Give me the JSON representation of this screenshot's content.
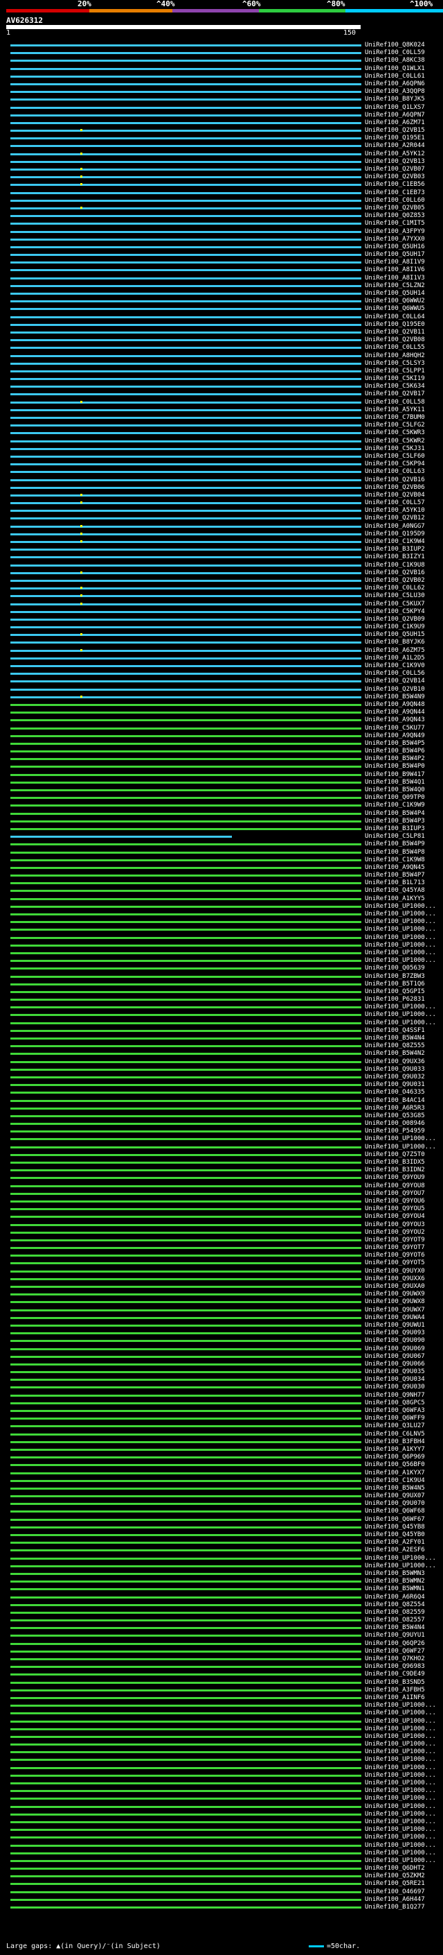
{
  "scale": {
    "labels": [
      "20%",
      "^40%",
      "^60%",
      "^80%",
      "^100%"
    ],
    "colors": [
      "#d40000",
      "#e67e00",
      "#8e44ad",
      "#2ecc40",
      "#00ccff"
    ]
  },
  "query": {
    "name": "AV626312",
    "start": "1",
    "end": "150"
  },
  "hits": [
    {
      "label": "UniRef100_Q8K024",
      "color": "#3cc8f0"
    },
    {
      "label": "UniRef100_C0LL59",
      "color": "#3cc8f0"
    },
    {
      "label": "UniRef100_A8KC38",
      "color": "#3cc8f0"
    },
    {
      "label": "UniRef100_Q1WLX1",
      "color": "#3cc8f0"
    },
    {
      "label": "UniRef100_C0LL61",
      "color": "#3cc8f0"
    },
    {
      "label": "UniRef100_A6QPN6",
      "color": "#3cc8f0"
    },
    {
      "label": "UniRef100_A3QQP8",
      "color": "#3cc8f0"
    },
    {
      "label": "UniRef100_B8YJK5",
      "color": "#3cc8f0"
    },
    {
      "label": "UniRef100_Q1LXS7",
      "color": "#3cc8f0"
    },
    {
      "label": "UniRef100_A6QPN7",
      "color": "#3cc8f0"
    },
    {
      "label": "UniRef100_A6ZM71",
      "color": "#3cc8f0"
    },
    {
      "label": "UniRef100_Q2VB15",
      "color": "#3cc8f0"
    },
    {
      "label": "UniRef100_Q195E1",
      "color": "#3cc8f0"
    },
    {
      "label": "UniRef100_A2R044",
      "color": "#3cc8f0"
    },
    {
      "label": "UniRef100_A5YK12",
      "color": "#3cc8f0"
    },
    {
      "label": "UniRef100_Q2VB13",
      "color": "#3cc8f0"
    },
    {
      "label": "UniRef100_Q2VB07",
      "color": "#3cc8f0"
    },
    {
      "label": "UniRef100_Q2VB03",
      "color": "#3cc8f0"
    },
    {
      "label": "UniRef100_C1EB56",
      "color": "#3cc8f0"
    },
    {
      "label": "UniRef100_C1EB73",
      "color": "#3cc8f0"
    },
    {
      "label": "UniRef100_C0LL60",
      "color": "#3cc8f0"
    },
    {
      "label": "UniRef100_Q2VB05",
      "color": "#3cc8f0"
    },
    {
      "label": "UniRef100_Q0Z853",
      "color": "#3cc8f0"
    },
    {
      "label": "UniRef100_C1MIT5",
      "color": "#3cc8f0"
    },
    {
      "label": "UniRef100_A3FPY9",
      "color": "#3cc8f0"
    },
    {
      "label": "UniRef100_A7YXX0",
      "color": "#3cc8f0"
    },
    {
      "label": "UniRef100_Q5UH16",
      "color": "#3cc8f0"
    },
    {
      "label": "UniRef100_Q5UH17",
      "color": "#3cc8f0"
    },
    {
      "label": "UniRef100_A8I1V9",
      "color": "#3cc8f0"
    },
    {
      "label": "UniRef100_A8I1V6",
      "color": "#3cc8f0"
    },
    {
      "label": "UniRef100_A8I1V3",
      "color": "#3cc8f0"
    },
    {
      "label": "UniRef100_C5LZN2",
      "color": "#3cc8f0"
    },
    {
      "label": "UniRef100_Q5UH14",
      "color": "#3cc8f0"
    },
    {
      "label": "UniRef100_Q6WWU2",
      "color": "#3cc8f0"
    },
    {
      "label": "UniRef100_Q6WWU5",
      "color": "#3cc8f0"
    },
    {
      "label": "UniRef100_C0LL64",
      "color": "#3cc8f0"
    },
    {
      "label": "UniRef100_Q195E0",
      "color": "#3cc8f0"
    },
    {
      "label": "UniRef100_Q2VB11",
      "color": "#3cc8f0"
    },
    {
      "label": "UniRef100_Q2VB08",
      "color": "#3cc8f0"
    },
    {
      "label": "UniRef100_C0LL55",
      "color": "#3cc8f0"
    },
    {
      "label": "UniRef100_A8HQH2",
      "color": "#3cc8f0"
    },
    {
      "label": "UniRef100_C5LSY3",
      "color": "#3cc8f0"
    },
    {
      "label": "UniRef100_C5LPP1",
      "color": "#3cc8f0"
    },
    {
      "label": "UniRef100_C5KI19",
      "color": "#3cc8f0"
    },
    {
      "label": "UniRef100_C5K634",
      "color": "#3cc8f0"
    },
    {
      "label": "UniRef100_Q2VB17",
      "color": "#3cc8f0"
    },
    {
      "label": "UniRef100_C0LL58",
      "color": "#3cc8f0"
    },
    {
      "label": "UniRef100_A5YK11",
      "color": "#3cc8f0"
    },
    {
      "label": "UniRef100_C7BUM0",
      "color": "#3cc8f0"
    },
    {
      "label": "UniRef100_C5LFG2",
      "color": "#3cc8f0"
    },
    {
      "label": "UniRef100_C5KWR3",
      "color": "#3cc8f0"
    },
    {
      "label": "UniRef100_C5KWR2",
      "color": "#3cc8f0"
    },
    {
      "label": "UniRef100_C5KJ31",
      "color": "#3cc8f0"
    },
    {
      "label": "UniRef100_C5LF60",
      "color": "#3cc8f0"
    },
    {
      "label": "UniRef100_C5KP94",
      "color": "#3cc8f0"
    },
    {
      "label": "UniRef100_C0LL63",
      "color": "#3cc8f0"
    },
    {
      "label": "UniRef100_Q2VB16",
      "color": "#3cc8f0"
    },
    {
      "label": "UniRef100_Q2VB06",
      "color": "#3cc8f0"
    },
    {
      "label": "UniRef100_Q2VB04",
      "color": "#3cc8f0"
    },
    {
      "label": "UniRef100_C0LL57",
      "color": "#3cc8f0"
    },
    {
      "label": "UniRef100_A5YK10",
      "color": "#3cc8f0"
    },
    {
      "label": "UniRef100_Q2VB12",
      "color": "#3cc8f0"
    },
    {
      "label": "UniRef100_A0NGG7",
      "color": "#3cc8f0"
    },
    {
      "label": "UniRef100_Q195D9",
      "color": "#3cc8f0"
    },
    {
      "label": "UniRef100_C1K9W4",
      "color": "#3cc8f0"
    },
    {
      "label": "UniRef100_B3IUP2",
      "color": "#3cc8f0"
    },
    {
      "label": "UniRef100_B3IZY1",
      "color": "#3cc8f0"
    },
    {
      "label": "UniRef100_C1K9U8",
      "color": "#3cc8f0"
    },
    {
      "label": "UniRef100_Q2VB16",
      "color": "#3cc8f0"
    },
    {
      "label": "UniRef100_Q2VB02",
      "color": "#3cc8f0"
    },
    {
      "label": "UniRef100_C0LL62",
      "color": "#3cc8f0"
    },
    {
      "label": "UniRef100_C5LU30",
      "color": "#3cc8f0"
    },
    {
      "label": "UniRef100_C5KUX7",
      "color": "#3cc8f0"
    },
    {
      "label": "UniRef100_C5KPY4",
      "color": "#3cc8f0"
    },
    {
      "label": "UniRef100_Q2VB09",
      "color": "#3cc8f0"
    },
    {
      "label": "UniRef100_C1K9U9",
      "color": "#3cc8f0"
    },
    {
      "label": "UniRef100_Q5UH15",
      "color": "#3cc8f0"
    },
    {
      "label": "UniRef100_B8YJK6",
      "color": "#3cc8f0"
    },
    {
      "label": "UniRef100_A6ZM75",
      "color": "#3cc8f0"
    },
    {
      "label": "UniRef100_A1L2D5",
      "color": "#3cc8f0"
    },
    {
      "label": "UniRef100_C1K9V0",
      "color": "#3cc8f0"
    },
    {
      "label": "UniRef100_C0LL56",
      "color": "#3cc8f0"
    },
    {
      "label": "UniRef100_Q2VB14",
      "color": "#3cc8f0"
    },
    {
      "label": "UniRef100_Q2VB10",
      "color": "#3cc8f0"
    },
    {
      "label": "UniRef100_B5W4N9",
      "color": "#3cc8f0"
    },
    {
      "label": "UniRef100_A9QN48",
      "color": "#40d838"
    },
    {
      "label": "UniRef100_A9QN44",
      "color": "#40d838"
    },
    {
      "label": "UniRef100_A9QN43",
      "color": "#40d838"
    },
    {
      "label": "UniRef100_C5KU77",
      "color": "#40d838"
    },
    {
      "label": "UniRef100_A9QN49",
      "color": "#40d838"
    },
    {
      "label": "UniRef100_B5W4P5",
      "color": "#40d838"
    },
    {
      "label": "UniRef100_B5W4P6",
      "color": "#40d838"
    },
    {
      "label": "UniRef100_B5W4P2",
      "color": "#40d838"
    },
    {
      "label": "UniRef100_B5W4P0",
      "color": "#40d838"
    },
    {
      "label": "UniRef100_B9W417",
      "color": "#40d838"
    },
    {
      "label": "UniRef100_B5W4Q1",
      "color": "#40d838"
    },
    {
      "label": "UniRef100_B5W4Q0",
      "color": "#40d838"
    },
    {
      "label": "UniRef100_Q09TP0",
      "color": "#40d838"
    },
    {
      "label": "UniRef100_C1K9W9",
      "color": "#40d838"
    },
    {
      "label": "UniRef100_B5W4P4",
      "color": "#40d838"
    },
    {
      "label": "UniRef100_B5W4P3",
      "color": "#40d838"
    },
    {
      "label": "UniRef100_B3IUP3",
      "color": "#40d838"
    },
    {
      "label": "UniRef100_C5LP81",
      "color": "#3cc8f0"
    },
    {
      "label": "UniRef100_B5W4P9",
      "color": "#40d838"
    },
    {
      "label": "UniRef100_B5W4P8",
      "color": "#40d838"
    },
    {
      "label": "UniRef100_C1K9W8",
      "color": "#40d838"
    },
    {
      "label": "UniRef100_A9QN45",
      "color": "#40d838"
    },
    {
      "label": "UniRef100_B5W4P7",
      "color": "#40d838"
    },
    {
      "label": "UniRef100_B1L713",
      "color": "#40d838"
    },
    {
      "label": "UniRef100_Q45YA8",
      "color": "#40d838"
    },
    {
      "label": "UniRef100_A1KYY5",
      "color": "#40d838"
    },
    {
      "label": "UniRef100_UP1000...",
      "color": "#40d838"
    },
    {
      "label": "UniRef100_UP1000...",
      "color": "#40d838"
    },
    {
      "label": "UniRef100_UP1000...",
      "color": "#40d838"
    },
    {
      "label": "UniRef100_UP1000...",
      "color": "#40d838"
    },
    {
      "label": "UniRef100_UP1000...",
      "color": "#40d838"
    },
    {
      "label": "UniRef100_UP1000...",
      "color": "#40d838"
    },
    {
      "label": "UniRef100_UP1000...",
      "color": "#40d838"
    },
    {
      "label": "UniRef100_UP1000...",
      "color": "#40d838"
    },
    {
      "label": "UniRef100_Q05639",
      "color": "#40d838"
    },
    {
      "label": "UniRef100_B7ZBW3",
      "color": "#40d838"
    },
    {
      "label": "UniRef100_B5T1Q6",
      "color": "#40d838"
    },
    {
      "label": "UniRef100_Q5GPI5",
      "color": "#40d838"
    },
    {
      "label": "UniRef100_P62831",
      "color": "#40d838"
    },
    {
      "label": "UniRef100_UP1000...",
      "color": "#40d838"
    },
    {
      "label": "UniRef100_UP1000...",
      "color": "#40d838"
    },
    {
      "label": "UniRef100_UP1000...",
      "color": "#40d838"
    },
    {
      "label": "UniRef100_Q4SSF1",
      "color": "#40d838"
    },
    {
      "label": "UniRef100_B5W4N4",
      "color": "#40d838"
    },
    {
      "label": "UniRef100_Q8Z555",
      "color": "#40d838"
    },
    {
      "label": "UniRef100_B5W4N2",
      "color": "#40d838"
    },
    {
      "label": "UniRef100_Q9UX36",
      "color": "#40d838"
    },
    {
      "label": "UniRef100_Q9U033",
      "color": "#40d838"
    },
    {
      "label": "UniRef100_Q9U032",
      "color": "#40d838"
    },
    {
      "label": "UniRef100_Q9U031",
      "color": "#40d838"
    },
    {
      "label": "UniRef100_O46335",
      "color": "#40d838"
    },
    {
      "label": "UniRef100_B4AC14",
      "color": "#40d838"
    },
    {
      "label": "UniRef100_A6R5R3",
      "color": "#40d838"
    },
    {
      "label": "UniRef100_Q53G85",
      "color": "#40d838"
    },
    {
      "label": "UniRef100_O08946",
      "color": "#40d838"
    },
    {
      "label": "UniRef100_P54959",
      "color": "#40d838"
    },
    {
      "label": "UniRef100_UP1000...",
      "color": "#40d838"
    },
    {
      "label": "UniRef100_UP1000...",
      "color": "#40d838"
    },
    {
      "label": "UniRef100_Q7Z5T0",
      "color": "#40d838"
    },
    {
      "label": "UniRef100_B3IDX5",
      "color": "#40d838"
    },
    {
      "label": "UniRef100_B3IDN2",
      "color": "#40d838"
    },
    {
      "label": "UniRef100_Q9YOU9",
      "color": "#40d838"
    },
    {
      "label": "UniRef100_Q9YOU8",
      "color": "#40d838"
    },
    {
      "label": "UniRef100_Q9YOU7",
      "color": "#40d838"
    },
    {
      "label": "UniRef100_Q9YOU6",
      "color": "#40d838"
    },
    {
      "label": "UniRef100_Q9YOU5",
      "color": "#40d838"
    },
    {
      "label": "UniRef100_Q9YOU4",
      "color": "#40d838"
    },
    {
      "label": "UniRef100_Q9YOU3",
      "color": "#40d838"
    },
    {
      "label": "UniRef100_Q9YOU2",
      "color": "#40d838"
    },
    {
      "label": "UniRef100_Q9YOT9",
      "color": "#40d838"
    },
    {
      "label": "UniRef100_Q9YOT7",
      "color": "#40d838"
    },
    {
      "label": "UniRef100_Q9YOT6",
      "color": "#40d838"
    },
    {
      "label": "UniRef100_Q9YOT5",
      "color": "#40d838"
    },
    {
      "label": "UniRef100_Q9UYX0",
      "color": "#40d838"
    },
    {
      "label": "UniRef100_Q9UXX6",
      "color": "#40d838"
    },
    {
      "label": "UniRef100_Q9UXA0",
      "color": "#40d838"
    },
    {
      "label": "UniRef100_Q9UWX9",
      "color": "#40d838"
    },
    {
      "label": "UniRef100_Q9UWX8",
      "color": "#40d838"
    },
    {
      "label": "UniRef100_Q9UWX7",
      "color": "#40d838"
    },
    {
      "label": "UniRef100_Q9UWA4",
      "color": "#40d838"
    },
    {
      "label": "UniRef100_Q9UWU1",
      "color": "#40d838"
    },
    {
      "label": "UniRef100_Q9U093",
      "color": "#40d838"
    },
    {
      "label": "UniRef100_Q9U090",
      "color": "#40d838"
    },
    {
      "label": "UniRef100_Q9U069",
      "color": "#40d838"
    },
    {
      "label": "UniRef100_Q9U067",
      "color": "#40d838"
    },
    {
      "label": "UniRef100_Q9U066",
      "color": "#40d838"
    },
    {
      "label": "UniRef100_Q9U035",
      "color": "#40d838"
    },
    {
      "label": "UniRef100_Q9U034",
      "color": "#40d838"
    },
    {
      "label": "UniRef100_Q9U030",
      "color": "#40d838"
    },
    {
      "label": "UniRef100_Q9NH77",
      "color": "#40d838"
    },
    {
      "label": "UniRef100_Q8GPC5",
      "color": "#40d838"
    },
    {
      "label": "UniRef100_Q6WFA3",
      "color": "#40d838"
    },
    {
      "label": "UniRef100_Q6WFF9",
      "color": "#40d838"
    },
    {
      "label": "UniRef100_Q3LU27",
      "color": "#40d838"
    },
    {
      "label": "UniRef100_C6LNV5",
      "color": "#40d838"
    },
    {
      "label": "UniRef100_B3FBH4",
      "color": "#40d838"
    },
    {
      "label": "UniRef100_A1KYY7",
      "color": "#40d838"
    },
    {
      "label": "UniRef100_Q6P969",
      "color": "#40d838"
    },
    {
      "label": "UniRef100_Q56BF0",
      "color": "#40d838"
    },
    {
      "label": "UniRef100_A1KYX7",
      "color": "#40d838"
    },
    {
      "label": "UniRef100_C1K9U4",
      "color": "#40d838"
    },
    {
      "label": "UniRef100_B5W4N5",
      "color": "#40d838"
    },
    {
      "label": "UniRef100_Q9UX07",
      "color": "#40d838"
    },
    {
      "label": "UniRef100_Q9U070",
      "color": "#40d838"
    },
    {
      "label": "UniRef100_Q6WF68",
      "color": "#40d838"
    },
    {
      "label": "UniRef100_Q6WF67",
      "color": "#40d838"
    },
    {
      "label": "UniRef100_Q45YB8",
      "color": "#40d838"
    },
    {
      "label": "UniRef100_Q45YB0",
      "color": "#40d838"
    },
    {
      "label": "UniRef100_A2FY01",
      "color": "#40d838"
    },
    {
      "label": "UniRef100_A2ESF6",
      "color": "#40d838"
    },
    {
      "label": "UniRef100_UP1000...",
      "color": "#40d838"
    },
    {
      "label": "UniRef100_UP1000...",
      "color": "#40d838"
    },
    {
      "label": "UniRef100_B5WMN3",
      "color": "#40d838"
    },
    {
      "label": "UniRef100_B5WMN2",
      "color": "#40d838"
    },
    {
      "label": "UniRef100_B5WMN1",
      "color": "#40d838"
    },
    {
      "label": "UniRef100_A6R6Q4",
      "color": "#40d838"
    },
    {
      "label": "UniRef100_Q8Z554",
      "color": "#40d838"
    },
    {
      "label": "UniRef100_O82559",
      "color": "#40d838"
    },
    {
      "label": "UniRef100_O82557",
      "color": "#40d838"
    },
    {
      "label": "UniRef100_B5W4N4",
      "color": "#40d838"
    },
    {
      "label": "UniRef100_Q9UYU1",
      "color": "#40d838"
    },
    {
      "label": "UniRef100_Q6QP26",
      "color": "#40d838"
    },
    {
      "label": "UniRef100_Q6WF27",
      "color": "#40d838"
    },
    {
      "label": "UniRef100_Q7KHO2",
      "color": "#40d838"
    },
    {
      "label": "UniRef100_Q96983",
      "color": "#40d838"
    },
    {
      "label": "UniRef100_C9DE49",
      "color": "#40d838"
    },
    {
      "label": "UniRef100_B3SND5",
      "color": "#40d838"
    },
    {
      "label": "UniRef100_A3FBH5",
      "color": "#40d838"
    },
    {
      "label": "UniRef100_A1INF6",
      "color": "#40d838"
    },
    {
      "label": "UniRef100_UP1000...",
      "color": "#40d838"
    },
    {
      "label": "UniRef100_UP1000...",
      "color": "#40d838"
    },
    {
      "label": "UniRef100_UP1000...",
      "color": "#40d838"
    },
    {
      "label": "UniRef100_UP1000...",
      "color": "#40d838"
    },
    {
      "label": "UniRef100_UP1000...",
      "color": "#40d838"
    },
    {
      "label": "UniRef100_UP1000...",
      "color": "#40d838"
    },
    {
      "label": "UniRef100_UP1000...",
      "color": "#40d838"
    },
    {
      "label": "UniRef100_UP1000...",
      "color": "#40d838"
    },
    {
      "label": "UniRef100_UP1000...",
      "color": "#40d838"
    },
    {
      "label": "UniRef100_UP1000...",
      "color": "#40d838"
    },
    {
      "label": "UniRef100_UP1000...",
      "color": "#40d838"
    },
    {
      "label": "UniRef100_UP1000...",
      "color": "#40d838"
    },
    {
      "label": "UniRef100_UP1000...",
      "color": "#40d838"
    },
    {
      "label": "UniRef100_UP1000...",
      "color": "#40d838"
    },
    {
      "label": "UniRef100_UP1000...",
      "color": "#40d838"
    },
    {
      "label": "UniRef100_UP1000...",
      "color": "#40d838"
    },
    {
      "label": "UniRef100_UP1000...",
      "color": "#40d838"
    },
    {
      "label": "UniRef100_UP1000...",
      "color": "#40d838"
    },
    {
      "label": "UniRef100_UP1000...",
      "color": "#40d838"
    },
    {
      "label": "UniRef100_UP1000...",
      "color": "#40d838"
    },
    {
      "label": "UniRef100_UP1000...",
      "color": "#40d838"
    },
    {
      "label": "UniRef100_Q6DHT2",
      "color": "#40d838"
    },
    {
      "label": "UniRef100_Q5ZKM2",
      "color": "#40d838"
    },
    {
      "label": "UniRef100_Q5RE21",
      "color": "#40d838"
    },
    {
      "label": "UniRef100_O46697",
      "color": "#40d838"
    },
    {
      "label": "UniRef100_A6H447",
      "color": "#40d838"
    },
    {
      "label": "UniRef100_B1Q277",
      "color": "#40d838"
    }
  ],
  "legend": {
    "gaps_text": "Large gaps: ▲(in Query)/⁻(in Subject)",
    "scale_text": "=50char."
  }
}
